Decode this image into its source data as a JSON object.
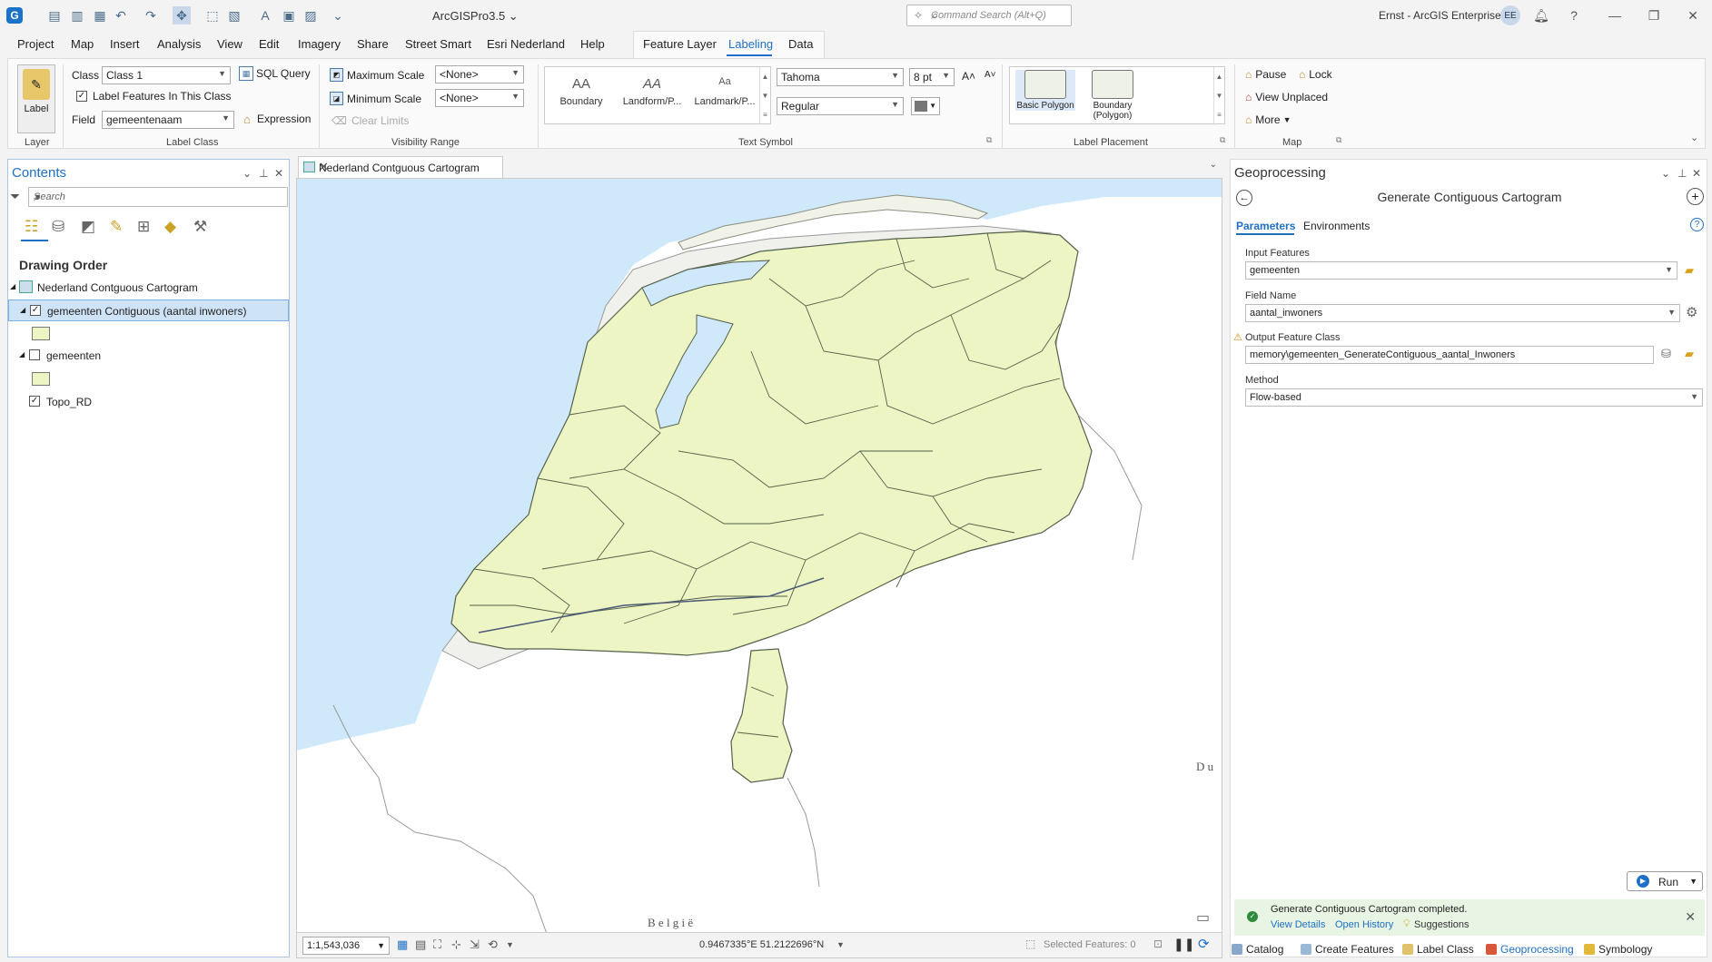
{
  "titlebar": {
    "app_title": "ArcGISPro3.5 ⌄",
    "command_search_placeholder": "Command Search (Alt+Q)",
    "user": "Ernst - ArcGIS Enterprise",
    "avatar": "EE"
  },
  "menu": {
    "tabs": [
      "Project",
      "Map",
      "Insert",
      "Analysis",
      "View",
      "Edit",
      "Imagery",
      "Share",
      "Street Smart",
      "Esri Nederland",
      "Help"
    ],
    "context_tabs": [
      "Feature Layer",
      "Labeling",
      "Data"
    ]
  },
  "ribbon": {
    "layer_group": {
      "button": "Label",
      "title": "Layer"
    },
    "label_class": {
      "class_label": "Class",
      "class_value": "Class 1",
      "sql_query": "SQL Query",
      "label_features": "Label Features In This Class",
      "field_label": "Field",
      "field_value": "gemeentenaam",
      "expression": "Expression",
      "title": "Label Class"
    },
    "visibility": {
      "max_scale": "Maximum Scale",
      "max_value": "<None>",
      "min_scale": "Minimum Scale",
      "min_value": "<None>",
      "clear_limits": "Clear Limits",
      "title": "Visibility Range"
    },
    "text_symbol": {
      "items": [
        "Boundary",
        "Landform/P...",
        "Landmark/P..."
      ],
      "glyphs": [
        "AA",
        "AA",
        "Aa"
      ],
      "font": "Tahoma",
      "size": "8 pt",
      "style": "Regular",
      "grow": "A˄",
      "shrink": "A˅",
      "title": "Text Symbol"
    },
    "label_placement": {
      "basic": "Basic Polygon",
      "boundary": "Boundary (Polygon)",
      "title": "Label Placement"
    },
    "map_group": {
      "pause": "Pause",
      "lock": "Lock",
      "view_unplaced": "View Unplaced",
      "more": "More",
      "title": "Map"
    }
  },
  "contents": {
    "title": "Contents",
    "search_placeholder": "Search",
    "drawing_order": "Drawing Order",
    "map_name": "Nederland Contguous Cartogram",
    "layers": [
      {
        "name": "gemeenten Contiguous (aantal inwoners)",
        "checked": "✓"
      },
      {
        "name": "gemeenten",
        "checked": ""
      },
      {
        "name": "Topo_RD",
        "checked": "✓"
      }
    ]
  },
  "map_view": {
    "tab_title": "Nederland Contguous Cartogram",
    "label_belgie": "B e l g i ë",
    "label_du": "D u",
    "scale": "1:1,543,036",
    "coordinates": "0.9467335°E 51.2122696°N",
    "selected_features": "Selected Features: 0"
  },
  "geoprocessing": {
    "title": "Geoprocessing",
    "tool": "Generate Contiguous Cartogram",
    "tabs": [
      "Parameters",
      "Environments"
    ],
    "params": [
      {
        "label": "Input Features",
        "value": "gemeenten"
      },
      {
        "label": "Field Name",
        "value": "aantal_inwoners"
      },
      {
        "label": "Output Feature Class",
        "value": "memory\\gemeenten_GenerateContiguous_aantal_Inwoners"
      },
      {
        "label": "Method",
        "value": "Flow-based"
      }
    ],
    "run": "Run",
    "message": "Generate Contiguous Cartogram completed.",
    "view_details": "View Details",
    "open_history": "Open History",
    "suggestions": "Suggestions"
  },
  "bottom_tabs": [
    "Catalog",
    "Create Features",
    "Label Class",
    "Geoprocessing",
    "Symbology"
  ],
  "colors": {
    "accent": "#1e6fc5",
    "water": "#cfe9fb",
    "land": "#edf5c4",
    "cartogram_stroke": "#55604a"
  }
}
